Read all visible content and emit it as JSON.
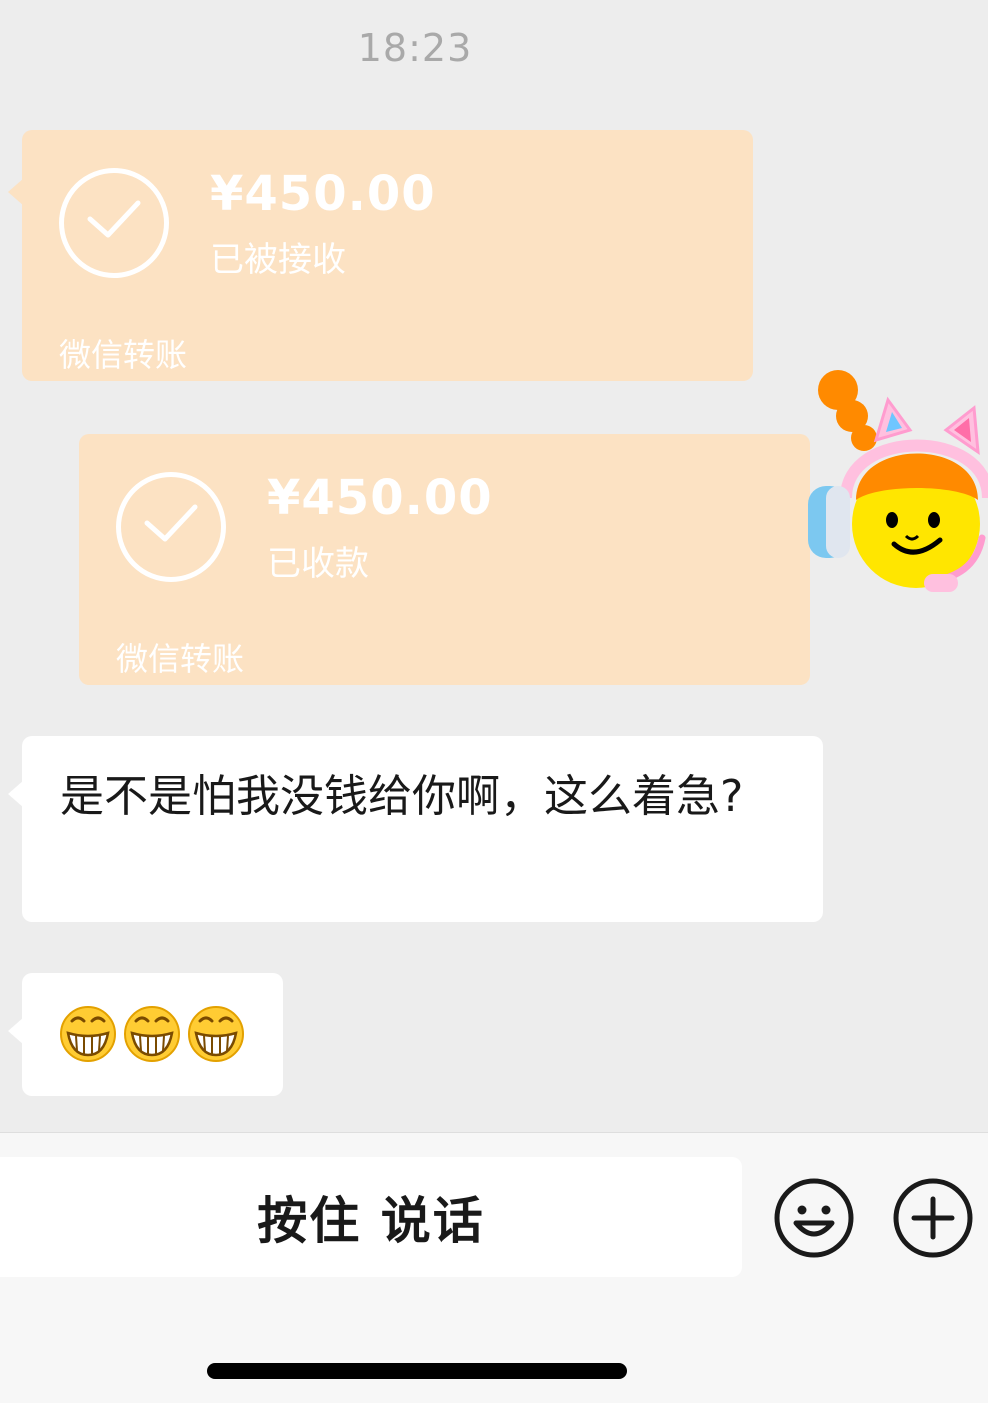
{
  "status_bar": {
    "time": "18:23"
  },
  "messages": {
    "transfer_received": {
      "amount": "¥450.00",
      "status": "已被接收",
      "label": "微信转账"
    },
    "transfer_collected": {
      "amount": "¥450.00",
      "status": "已收款",
      "label": "微信转账"
    },
    "text_message": "是不是怕我没钱给你啊，这么着急?",
    "emoji_message": {
      "emoji": "grin",
      "count": 3
    }
  },
  "input_bar": {
    "hold_to_talk_label": "按住 说话",
    "emoji_icon": "smiley-icon",
    "more_icon": "plus-circle-icon"
  },
  "colors": {
    "background": "#ededed",
    "transfer_card": "#fce2c3",
    "bubble": "#ffffff",
    "text": "#191919"
  }
}
